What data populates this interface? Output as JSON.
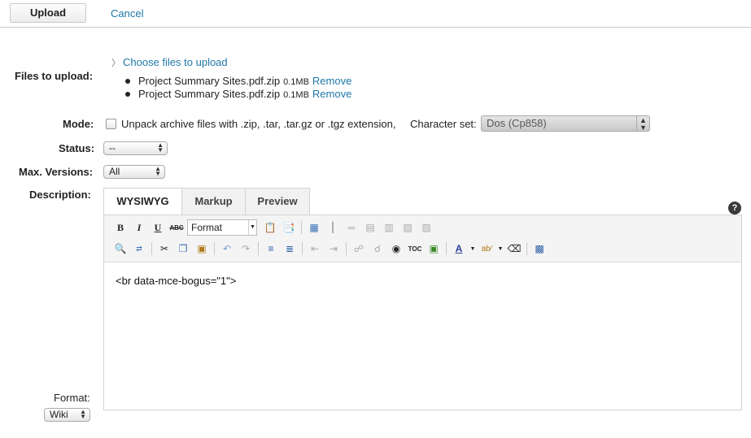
{
  "toolbar_top": {
    "upload_label": "Upload",
    "cancel_label": "Cancel"
  },
  "form": {
    "files_label": "Files to upload:",
    "choose_label": "Choose files to upload",
    "files": [
      {
        "name": "Project Summary Sites.pdf.zip",
        "size": "0.1MB",
        "remove": "Remove"
      },
      {
        "name": "Project Summary Sites.pdf.zip",
        "size": "0.1MB",
        "remove": "Remove"
      }
    ],
    "mode_label": "Mode:",
    "mode_text": "Unpack archive files with .zip, .tar, .tar.gz or .tgz extension,",
    "charset_label": "Character set:",
    "charset_value": "Dos (Cp858)",
    "status_label": "Status:",
    "status_value": "--",
    "versions_label": "Max. Versions:",
    "versions_value": "All",
    "description_label": "Description:",
    "format_label": "Format:",
    "format_value": "Wiki"
  },
  "editor": {
    "tabs": [
      "WYSIWYG",
      "Markup",
      "Preview"
    ],
    "help": "?",
    "format_dropdown": "Format",
    "content": "<br data-mce-bogus=\"1\">"
  }
}
